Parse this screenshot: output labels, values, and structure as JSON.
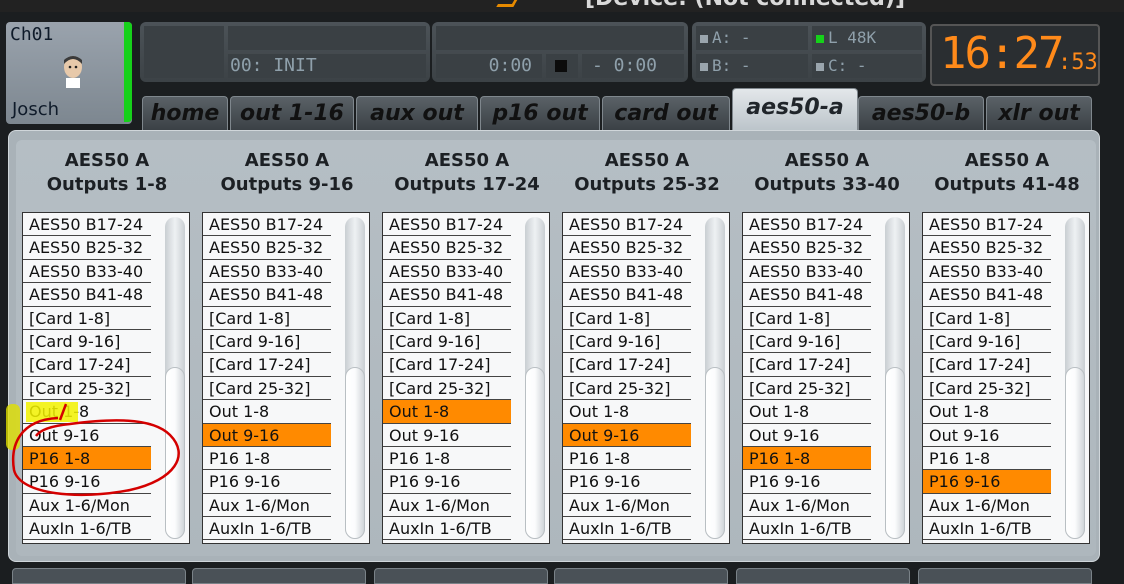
{
  "header": {
    "title_fragment": "[Device: (Not connected)]",
    "channel": {
      "id": "Ch01",
      "name": "Josch"
    },
    "scene": {
      "name": "00: INIT"
    },
    "transport": {
      "elapsed": "0:00",
      "remaining": "- 0:00"
    },
    "status": {
      "a": "A:  -",
      "b": "B:  -",
      "l": "L  48K",
      "c": "C:  -"
    },
    "clock": {
      "time": "16:27",
      "seconds": ":53"
    }
  },
  "tabs": [
    {
      "label": "home",
      "active": false
    },
    {
      "label": "out 1-16",
      "active": false
    },
    {
      "label": "aux out",
      "active": false
    },
    {
      "label": "p16 out",
      "active": false
    },
    {
      "label": "card out",
      "active": false
    },
    {
      "label": "aes50-a",
      "active": true
    },
    {
      "label": "aes50-b",
      "active": false
    },
    {
      "label": "xlr out",
      "active": false
    }
  ],
  "columns": [
    {
      "title": "AES50 A",
      "subtitle": "Outputs 1-8",
      "selected": "P16 1-8"
    },
    {
      "title": "AES50 A",
      "subtitle": "Outputs 9-16",
      "selected": "Out 9-16"
    },
    {
      "title": "AES50 A",
      "subtitle": "Outputs 17-24",
      "selected": "Out 1-8"
    },
    {
      "title": "AES50 A",
      "subtitle": "Outputs 25-32",
      "selected": "Out 9-16"
    },
    {
      "title": "AES50 A",
      "subtitle": "Outputs 33-40",
      "selected": "P16 1-8"
    },
    {
      "title": "AES50 A",
      "subtitle": "Outputs 41-48",
      "selected": "P16 9-16"
    }
  ],
  "list_items": [
    "AES50 B17-24",
    "AES50 B25-32",
    "AES50 B33-40",
    "AES50 B41-48",
    "[Card 1-8]",
    "[Card 9-16]",
    "[Card 17-24]",
    "[Card 25-32]",
    "Out 1-8",
    "Out 9-16",
    "P16 1-8",
    "P16 9-16",
    "Aux 1-6/Mon",
    "AuxIn 1-6/TB"
  ],
  "colors": {
    "accent": "#ff8a00",
    "status_green": "#16d11a",
    "highlight_yellow": "#f2f200",
    "annotation_red": "#d40000"
  }
}
